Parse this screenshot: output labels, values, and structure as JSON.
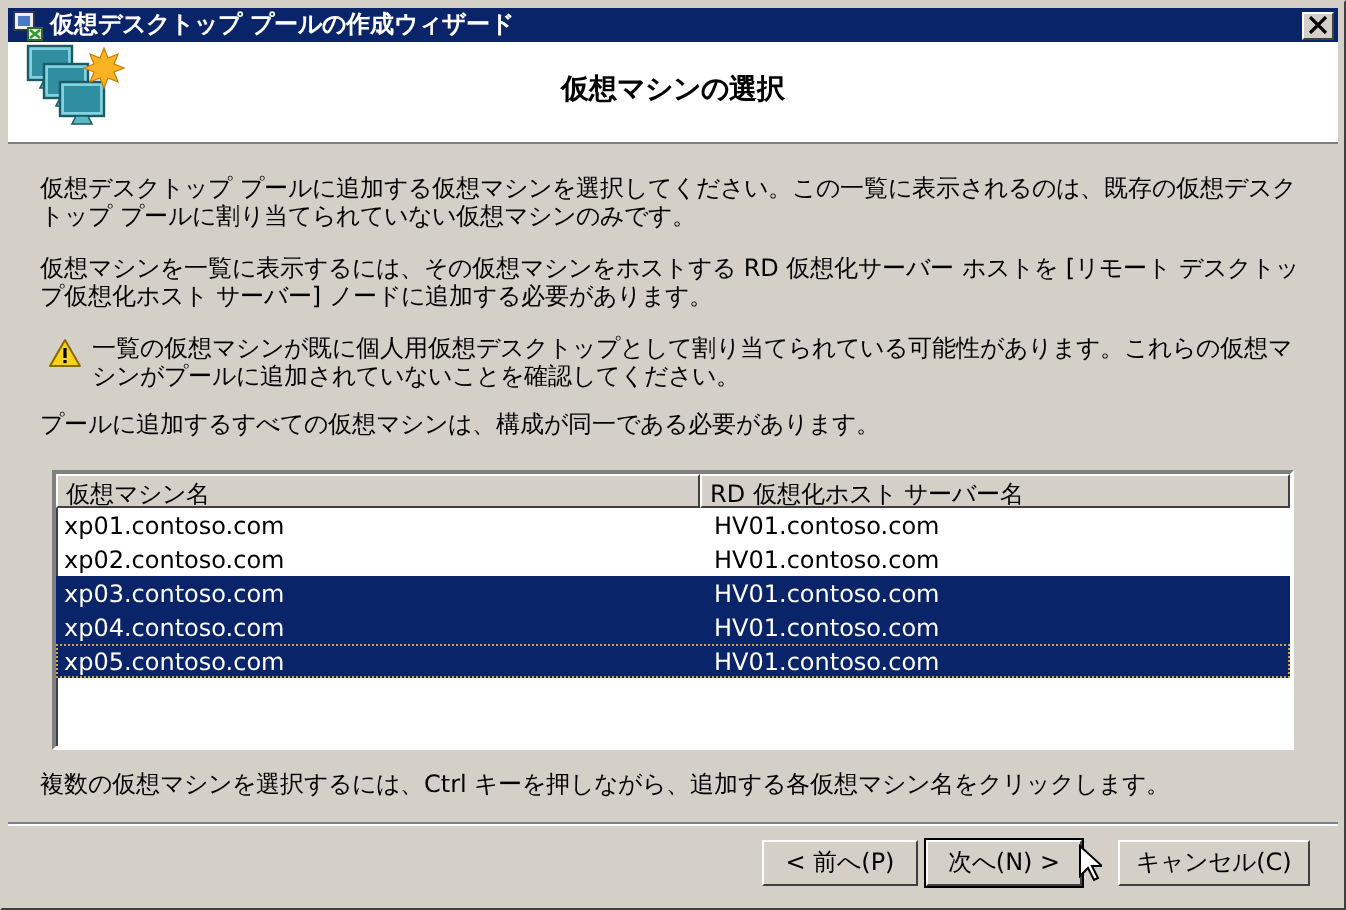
{
  "window": {
    "title": "仮想デスクトップ プールの作成ウィザード"
  },
  "header": {
    "title": "仮想マシンの選択"
  },
  "paragraphs": [
    {
      "kind": "text",
      "text": "仮想デスクトップ プールに追加する仮想マシンを選択してください。この一覧に表示されるのは、既存の仮想デスクトップ プールに割り当てられていない仮想マシンのみです。"
    },
    {
      "kind": "text",
      "text": "仮想マシンを一覧に表示するには、その仮想マシンをホストする RD 仮想化サーバー ホストを [リモート デスクトップ仮想化ホスト サーバー] ノードに追加する必要があります。"
    },
    {
      "kind": "warning",
      "text": "一覧の仮想マシンが既に個人用仮想デスクトップとして割り当てられている可能性があります。これらの仮想マシンがプールに追加されていないことを確認してください。"
    },
    {
      "kind": "text",
      "text": "プールに追加するすべての仮想マシンは、構成が同一である必要があります。"
    }
  ],
  "table": {
    "columns": [
      "仮想マシン名",
      "RD 仮想化ホスト サーバー名"
    ],
    "rows": [
      {
        "cells": [
          "xp01.contoso.com",
          "HV01.contoso.com"
        ],
        "selected": false,
        "focused": false
      },
      {
        "cells": [
          "xp02.contoso.com",
          "HV01.contoso.com"
        ],
        "selected": false,
        "focused": false
      },
      {
        "cells": [
          "xp03.contoso.com",
          "HV01.contoso.com"
        ],
        "selected": true,
        "focused": false
      },
      {
        "cells": [
          "xp04.contoso.com",
          "HV01.contoso.com"
        ],
        "selected": true,
        "focused": false
      },
      {
        "cells": [
          "xp05.contoso.com",
          "HV01.contoso.com"
        ],
        "selected": true,
        "focused": true
      }
    ]
  },
  "hint": "複数の仮想マシンを選択するには、Ctrl キーを押しながら、追加する各仮想マシン名をクリックします。",
  "buttons": [
    {
      "label": "< 前へ(P)",
      "default": false
    },
    {
      "label": "次へ(N) >",
      "default": true
    },
    {
      "label": "キャンセル(C)",
      "default": false
    }
  ]
}
